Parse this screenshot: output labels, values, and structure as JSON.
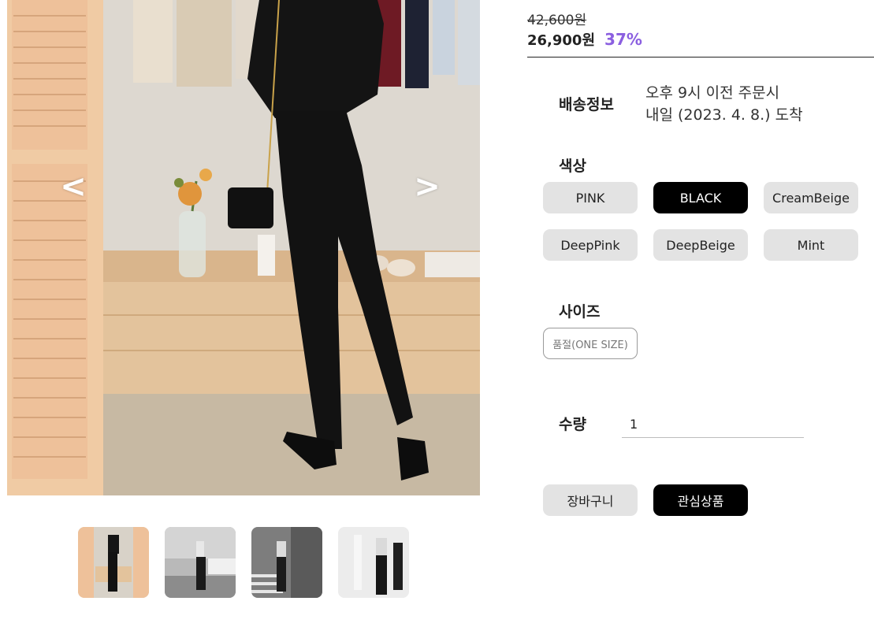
{
  "product": {
    "price_original": "42,600원",
    "price_sale": "26,900원",
    "discount": "37%"
  },
  "gallery": {
    "prev_label": "<",
    "next_label": ">",
    "thumbnails": [
      "thumb-1",
      "thumb-2",
      "thumb-3",
      "thumb-4"
    ],
    "selected_thumbnail": 1
  },
  "delivery": {
    "label": "배송정보",
    "line1": "오후 9시 이전 주문시",
    "line2": "내일 (2023. 4. 8.) 도착"
  },
  "color": {
    "label": "색상",
    "options": [
      "PINK",
      "BLACK",
      "CreamBeige",
      "DeepPink",
      "DeepBeige",
      "Mint"
    ],
    "selected": "BLACK"
  },
  "size": {
    "label": "사이즈",
    "options": [
      "품절(ONE SIZE)"
    ]
  },
  "quantity": {
    "label": "수량",
    "value": "1"
  },
  "actions": {
    "cart_label": "장바구니",
    "wishlist_label": "관심상품"
  },
  "colors": {
    "accent_discount": "#8b5fe0",
    "selected_chip": "#000000",
    "chip_bg": "#e3e3e3"
  }
}
